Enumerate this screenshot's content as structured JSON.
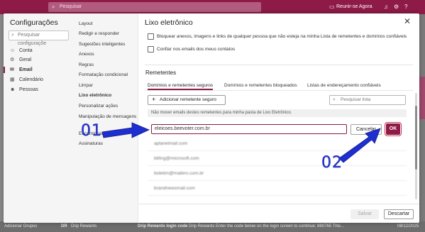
{
  "app": {
    "search_placeholder": "Pesquisar",
    "meet_now": "Reunir-se Agora",
    "footer": {
      "left": "Adicionar Grupos",
      "badge": "DR",
      "sender": "Drip Rewards",
      "subject": "Drip Rewards login code",
      "preview": "Drip Rewards Enter the code below on the login screen to continue: 880765 This...",
      "date": "08/12/2025"
    }
  },
  "settings": {
    "title": "Configurações",
    "search_placeholder": "Pesquisar configuraçõe",
    "nav": [
      {
        "label": "Conta",
        "icon": "person-icon"
      },
      {
        "label": "Geral",
        "icon": "gear-icon"
      },
      {
        "label": "Email",
        "icon": "mail-icon",
        "active": true
      },
      {
        "label": "Calendário",
        "icon": "calendar-icon"
      },
      {
        "label": "Pessoas",
        "icon": "people-icon"
      }
    ],
    "subnav": [
      {
        "label": "Layout"
      },
      {
        "label": "Redigir e responder"
      },
      {
        "label": "Sugestões inteligentes"
      },
      {
        "label": "Anexos"
      },
      {
        "label": "Regras"
      },
      {
        "label": "Formatação condicional"
      },
      {
        "label": "Limpar"
      },
      {
        "label": "Lixo eletrônico",
        "active": true
      },
      {
        "label": "Personalizar ações"
      },
      {
        "label": "Manipulação de mensagens"
      },
      {
        "label": "Encaminhamento"
      },
      {
        "label": "Assinaturas"
      }
    ]
  },
  "junk": {
    "title": "Lixo eletrônico",
    "checkbox_block": "Bloquear anexos, imagens e links de qualquer pessoa que não esteja na minha Lista de remetentes e domínios confiáveis",
    "checkbox_trust": "Confiar nos emails dos meus contatos",
    "section_title": "Remetentes",
    "tabs": [
      {
        "label": "Domínios e remetentes seguros",
        "active": true
      },
      {
        "label": "Domínios e remetentes bloqueados"
      },
      {
        "label": "Listas de endereçamento confiáveis"
      }
    ],
    "add_button": "Adicionar remetente seguro",
    "search_list_placeholder": "Pesquisar lista",
    "info_text": "Não mover emails destes remetentes para minha pasta de Lixo Eletrônico.",
    "email_value": "eleicoes.beevoter.com.br",
    "cancel_label": "Cancelar",
    "ok_label": "OK",
    "entries": [
      "aplanetmail.com",
      "billing@microsoft.com",
      "boletim@mailers.com.br",
      "brandnewsmail.com"
    ],
    "save_label": "Salvar",
    "discard_label": "Descartar"
  },
  "annotations": {
    "step1": "01",
    "step2": "02",
    "arrow_color": "#1e2fd0"
  }
}
